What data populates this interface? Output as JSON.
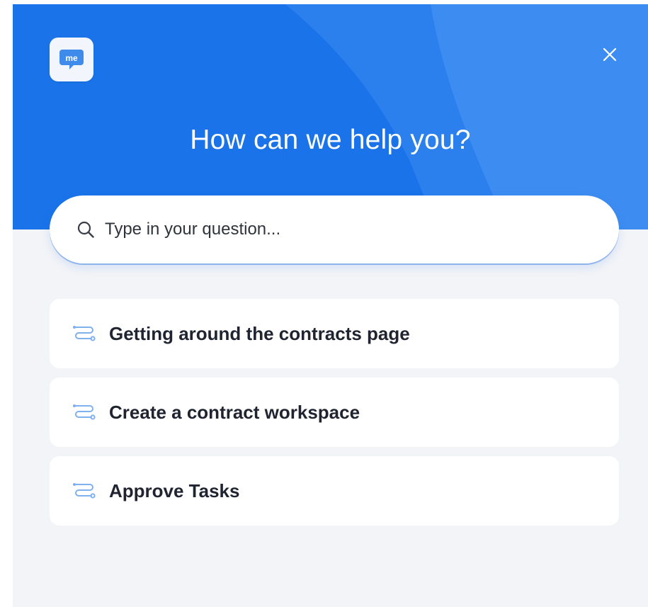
{
  "header": {
    "title": "How can we help you?",
    "logo_icon": "chat-bubble-logo-icon",
    "logo_text": "me",
    "close_icon": "close-icon"
  },
  "search": {
    "placeholder": "Type in your question...",
    "value": "",
    "icon": "search-icon"
  },
  "topics": [
    {
      "label": "Getting around the contracts page",
      "icon": "route-icon"
    },
    {
      "label": "Create a contract workspace",
      "icon": "route-icon"
    },
    {
      "label": "Approve Tasks",
      "icon": "route-icon"
    }
  ],
  "colors": {
    "header_blue": "#1a73e8",
    "panel_background": "#f3f4f7",
    "card_background": "#ffffff",
    "topic_text": "#1f2430",
    "icon_light_blue": "#7fb0ef"
  }
}
